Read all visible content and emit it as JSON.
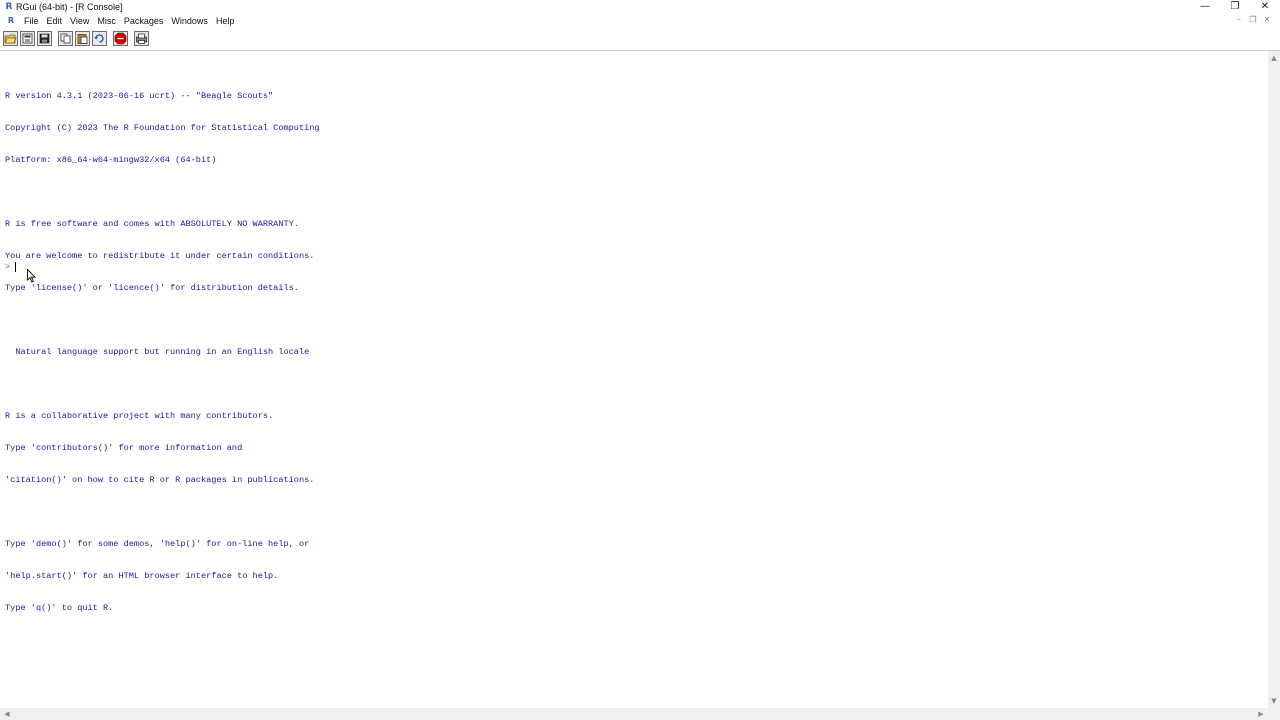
{
  "window": {
    "title": "RGui (64-bit) - [R Console]",
    "app_icon": "r-logo-icon",
    "controls": [
      "minimize-icon",
      "restore-icon",
      "close-icon"
    ]
  },
  "menubar": {
    "doc_icon": "r-console-icon",
    "items": [
      "File",
      "Edit",
      "View",
      "Misc",
      "Packages",
      "Windows",
      "Help"
    ]
  },
  "toolbar": {
    "buttons": [
      {
        "name": "open-script-icon"
      },
      {
        "name": "load-workspace-icon"
      },
      {
        "name": "save-workspace-icon"
      },
      {
        "name": "copy-icon"
      },
      {
        "name": "paste-icon"
      },
      {
        "name": "copy-paste-icon"
      },
      {
        "name": "stop-icon",
        "color": "#d40000"
      },
      {
        "name": "print-icon"
      }
    ]
  },
  "console": {
    "text_color": "#1a1a9e",
    "prompt_color": "#c04040",
    "lines": [
      "R version 4.3.1 (2023-06-16 ucrt) -- \"Beagle Scouts\"",
      "Copyright (C) 2023 The R Foundation for Statistical Computing",
      "Platform: x86_64-w64-mingw32/x64 (64-bit)",
      "",
      "R is free software and comes with ABSOLUTELY NO WARRANTY.",
      "You are welcome to redistribute it under certain conditions.",
      "Type 'license()' or 'licence()' for distribution details.",
      "",
      "  Natural language support but running in an English locale",
      "",
      "R is a collaborative project with many contributors.",
      "Type 'contributors()' for more information and",
      "'citation()' on how to cite R or R packages in publications.",
      "",
      "Type 'demo()' for some demos, 'help()' for on-line help, or",
      "'help.start()' for an HTML browser interface to help.",
      "Type 'q()' to quit R."
    ],
    "prompt": ">",
    "input_value": ""
  }
}
